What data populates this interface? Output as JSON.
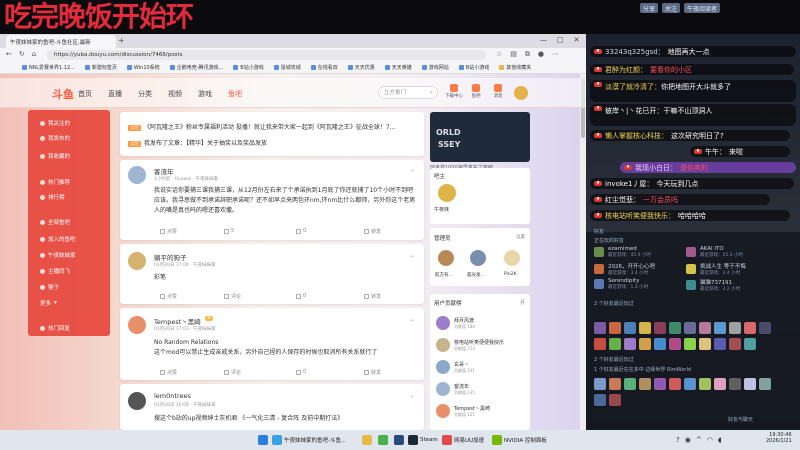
{
  "overlay": {
    "title": "吃完晚饭开始环"
  },
  "stream_controls": [
    "分享",
    "关注",
    "午夜阅读者"
  ],
  "browser": {
    "tabs": [
      "午夜妹妹家的鱼吧-斗鱼社区,最新",
      "午夜妹妹家的鱼吧-斗鱼社区,最新"
    ],
    "url": "https://yuba.douyu.com/discussion/7466/posts",
    "bookmarks": [
      "NRL爱赛世界1.12...",
      "新建标签页",
      "Win10系统",
      "企鹅电竞-腾讯游戏...",
      "B站小游戏",
      "鼠城攻城",
      "在线看双",
      "天天优惠",
      "天天英雄",
      "游戏网站",
      "B站小游戏"
    ],
    "bookmarks_other": "其他收藏夹"
  },
  "site": {
    "logo": "斗鱼",
    "nav": [
      "首页",
      "直播",
      "分类",
      "视频",
      "游戏",
      "鱼吧"
    ],
    "search_placeholder": "立方鲁门",
    "header_icons": [
      "下载中心",
      "鱼吧",
      "消息"
    ]
  },
  "sidebar": [
    "我关注的",
    "我发布的",
    "我收藏的",
    "热门推荐",
    "排行榜",
    "全部鱼吧",
    "加入的鱼吧",
    "午夜妹妹家",
    "主播同飞",
    "猴子",
    "更多",
    "热门回复"
  ],
  "announcements": [
    {
      "tag": "公告",
      "text": "《阿瓦隆之王》粉丝专属福利活动 投播！就让我来带大家一起到《阿瓦隆之王》征战全球！7..."
    },
    {
      "tag": "公告",
      "text": "我发布了文章：【精华】关于抽奖以及奖品发放"
    }
  ],
  "posts": [
    {
      "user": "客流年",
      "meta": "1小时前 · Huawei · 午夜妹妹家",
      "body": "我说实话你要捕三课我捕三课，从12月份左右来了个承诺执到1月底了你还就捕了10个小时不到吧应该。我寻思做不到承诺辞职承诺呢？还不如早点来两包环nm,环nm比什么都帅，另外你这个老男人的嘴是真也吗的嗯还喜欢撒。",
      "actions": [
        "点赞",
        "5",
        "0",
        "转发"
      ]
    },
    {
      "user": "躺平的狗子",
      "meta": "01月20日 17:04 · 午夜妹妹家",
      "body": "彩笔",
      "actions": [
        "点赞",
        "评论",
        "0",
        "转发"
      ]
    },
    {
      "user": "Tempest丶黑崎",
      "meta": "01月20日 17:03 · 午夜妹妹家",
      "body": "No Random Relations\n这个mod可以禁止生成亲戚关系，另外自己捏的人保存的时候也取消所有关系就行了",
      "actions": [
        "点赞",
        "评论",
        "0",
        "转发"
      ]
    },
    {
      "user": "lem0ntrees",
      "meta": "01月20日 16:09 · 午夜妹妹家",
      "body": "搜这个b站的up视频绅士灰机君 《一气化三清 - 复合阵 及前中期打法》",
      "actions": []
    }
  ],
  "right": {
    "banner": [
      "ORLD",
      "SSEY"
    ],
    "banner_caption": "环世界1000海里真实之旅吧",
    "admin_title": "吧主",
    "admin_name": "午夜妹",
    "managers_title": "管理员",
    "managers_action": "设置",
    "managers": [
      "航方有...",
      "晨光发...",
      "Pin2K"
    ],
    "ranking_title": "用户贡献榜",
    "ranking_tab": "月",
    "ranking": [
      {
        "name": "拜月风渡",
        "sub": "贡献值 184"
      },
      {
        "name": "核电站听笑便便我快乐",
        "sub": "贡献值 153"
      },
      {
        "name": "玄哥丶",
        "sub": "贡献值 141"
      },
      {
        "name": "客流年",
        "sub": "贡献值 135"
      },
      {
        "name": "Tempest丶黑崎",
        "sub": "贡献值 121"
      }
    ]
  },
  "chat": [
    {
      "level": "",
      "name": "33243q325gsd：",
      "text": "地图再大一点"
    },
    {
      "level": "",
      "name": "君醉为红颜：",
      "text": "要看你的小区"
    },
    {
      "level": "",
      "name": "淡漠了就冷清了：",
      "text": "你把地图开大斗就多了"
    },
    {
      "level": "",
      "name": "彼岸丶|丶花已开：",
      "text": "干嘛不山顶洞人"
    },
    {
      "level": "",
      "name": "懒人掌握核心科技：",
      "text": "这次研究明日了?"
    },
    {
      "level": "",
      "name": "午午：",
      "text": "来啦"
    },
    {
      "level": "",
      "name": "我现小白日：",
      "text": "是你卖的"
    },
    {
      "level": "",
      "name": "invoke1丿屋：",
      "text": "今天玩到几点"
    },
    {
      "level": "",
      "name": "红尘觉悲：",
      "text": "一万会员吗"
    },
    {
      "level": "",
      "name": "核电站听笑便我快乐：",
      "text": "哈哈哈哈"
    }
  ],
  "friends": {
    "header": "好友",
    "playing_title": "正在玩的好友",
    "list": [
      {
        "name": "ezamimed",
        "status": "最近游戏：45.9 小时"
      },
      {
        "name": "AKAI ITO",
        "status": "最近游戏：25.3 小时"
      },
      {
        "name": "2026，开开心心吧",
        "status": "最近游戏：3.4 小时"
      },
      {
        "name": "挑战人生 等于不悔",
        "status": "最近游戏：3.4 小时"
      },
      {
        "name": "Serendipity",
        "status": "最近游戏：1.3 小时"
      },
      {
        "name": "貓貓737191",
        "status": "最近游戏：3.2 小时"
      }
    ],
    "recent_title": "2 个好友最近玩过",
    "recent2": "2 个好友最近玩过",
    "game_line": "1 个好友最近在在多中 边缘世界 RimWorld",
    "chat_label": "好友与聊天"
  },
  "taskbar": {
    "items": [
      "午夜妹妹家的鱼吧-斗鱼...",
      "Steam",
      "网易UU加速",
      "NVIDIA 控制面板"
    ],
    "time": "19:30:46",
    "date": "2026/1/21"
  }
}
